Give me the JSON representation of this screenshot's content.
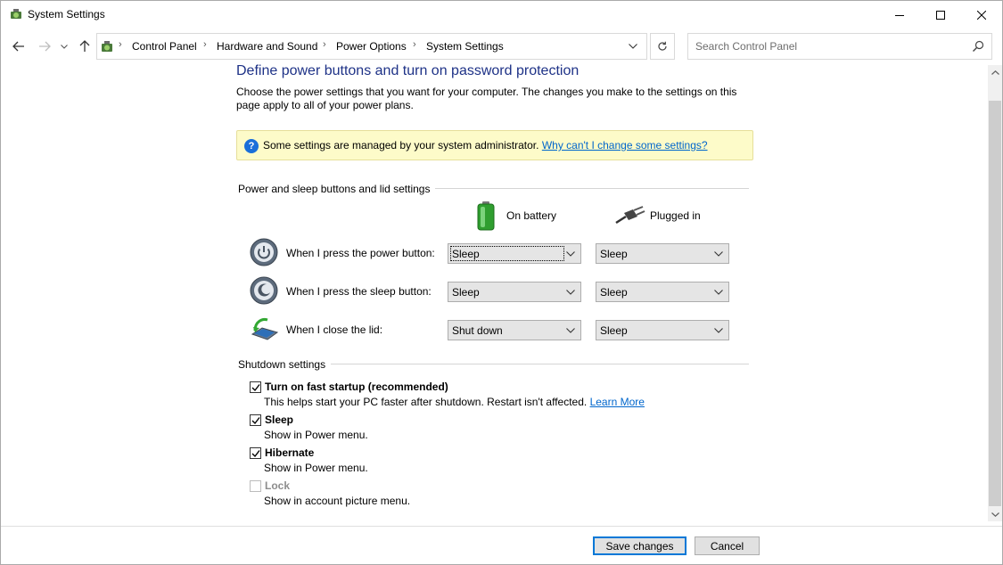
{
  "window": {
    "title": "System Settings"
  },
  "nav": {
    "breadcrumbs": [
      "Control Panel",
      "Hardware and Sound",
      "Power Options",
      "System Settings"
    ],
    "search_placeholder": "Search Control Panel"
  },
  "page": {
    "heading": "Define power buttons and turn on password protection",
    "description": "Choose the power settings that you want for your computer. The changes you make to the settings on this page apply to all of your power plans.",
    "info_message": "Some settings are managed by your system administrator.",
    "info_link": "Why can't I change some settings?"
  },
  "power_buttons": {
    "section_title": "Power and sleep buttons and lid settings",
    "col_battery": "On battery",
    "col_plugged": "Plugged in",
    "rows": [
      {
        "label": "When I press the power button:",
        "battery": "Sleep",
        "plugged": "Sleep"
      },
      {
        "label": "When I press the sleep button:",
        "battery": "Sleep",
        "plugged": "Sleep"
      },
      {
        "label": "When I close the lid:",
        "battery": "Shut down",
        "plugged": "Sleep"
      }
    ]
  },
  "shutdown": {
    "section_title": "Shutdown settings",
    "items": [
      {
        "label": "Turn on fast startup (recommended)",
        "desc": "This helps start your PC faster after shutdown. Restart isn't affected.",
        "link": "Learn More",
        "checked": true,
        "enabled": true
      },
      {
        "label": "Sleep",
        "desc": "Show in Power menu.",
        "checked": true,
        "enabled": true
      },
      {
        "label": "Hibernate",
        "desc": "Show in Power menu.",
        "checked": true,
        "enabled": true
      },
      {
        "label": "Lock",
        "desc": "Show in account picture menu.",
        "checked": false,
        "enabled": false
      }
    ]
  },
  "footer": {
    "save_label": "Save changes",
    "cancel_label": "Cancel"
  },
  "colors": {
    "heading": "#1e3287",
    "link": "#0066cc",
    "info_bg": "#fdfbc9",
    "primary_border": "#0078d7"
  }
}
